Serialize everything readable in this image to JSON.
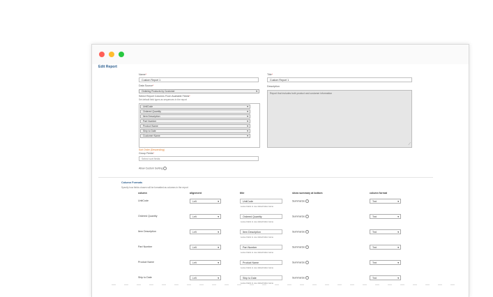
{
  "window": {
    "controls": [
      "close",
      "minimize",
      "maximize"
    ]
  },
  "page": {
    "title": "Edit Report"
  },
  "form": {
    "name_label": "Name",
    "name_value": "Custom Report 1",
    "title_label": "Title",
    "title_value": "Custom Report 1",
    "data_source_label": "Data Source",
    "data_source_value": "Ordering Products by Customer",
    "description_label": "Description",
    "description_value": "Report that includes both product and customer information",
    "select_columns_label": "Select Report Columns From Available Fields",
    "select_columns_hint": "Set default field types as sequences in the report",
    "available_fields": [
      "UnitCode",
      "Ordered Quantity",
      "Item Description",
      "Part Number",
      "Product Name",
      "Ship to Date",
      "Customer Name"
    ],
    "order_label": "Sort Order (Descending)",
    "group_label": "Group Fields",
    "group_value": "Select sort fields",
    "custom_sorting_label": "Allow Custom Sorting"
  },
  "column_formats": {
    "heading": "Column Formats",
    "hint": "Specify how fields chosen will be formatted as columns in the report",
    "headers": {
      "column": "column",
      "alignment": "alignment",
      "title": "title",
      "summary": "show summary at bottom",
      "format": "column format"
    },
    "title_hint": "Leave blank to use default label name",
    "summarize_label": "Summarize",
    "rows": [
      {
        "column": "UnitCode",
        "alignment": "Left",
        "title": "UnitCode",
        "format": "Text"
      },
      {
        "column": "Ordered Quantity",
        "alignment": "Left",
        "title": "Ordered Quantity",
        "format": "Text"
      },
      {
        "column": "Item Description",
        "alignment": "Left",
        "title": "Item Description",
        "format": "Text"
      },
      {
        "column": "Part Number",
        "alignment": "Left",
        "title": "Part Number",
        "format": "Text"
      },
      {
        "column": "Product Name",
        "alignment": "Left",
        "title": "Product Name",
        "format": "Text"
      },
      {
        "column": "Ship to Date",
        "alignment": "Left",
        "title": "Ship to Date",
        "format": "Text"
      }
    ]
  },
  "colors": {
    "heading": "#2d5f8f",
    "required": "#ee3333",
    "order_label": "#e07b28"
  }
}
